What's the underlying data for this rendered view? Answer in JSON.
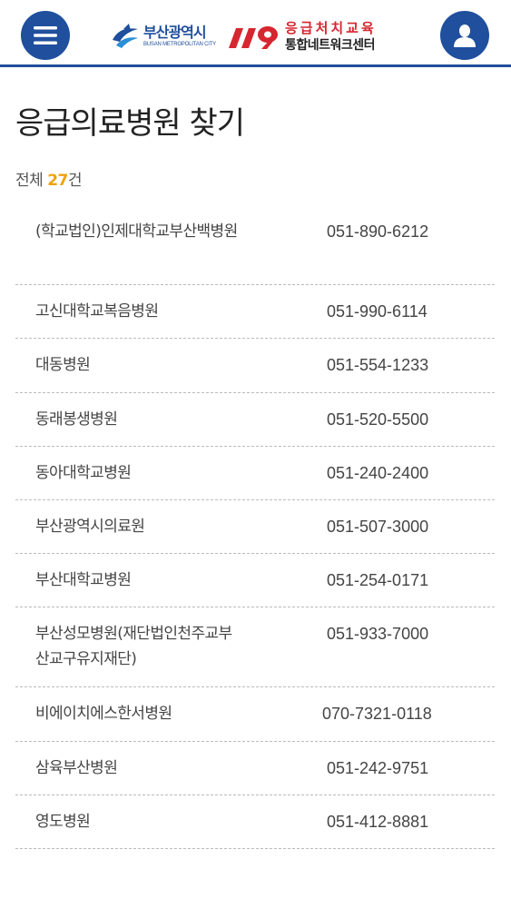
{
  "header": {
    "busan_name": "부산광역시",
    "busan_sub": "BUSAN METROPOLITAN CITY",
    "center_line1": "응급처치교육",
    "center_line2": "통합네트워크센터",
    "brand_color": "#1f4f9d",
    "accent_red": "#d6262f",
    "icons": [
      "menu-icon",
      "user-icon"
    ]
  },
  "page": {
    "title": "응급의료병원 찾기",
    "count_prefix": "전체 ",
    "count_value": "27",
    "count_suffix": "건",
    "count_color": "#f0a30a"
  },
  "hospitals": [
    {
      "name": "(학교법인)인제대학교부산백병원",
      "phone": "051-890-6212"
    },
    {
      "name": "고신대학교복음병원",
      "phone": "051-990-6114"
    },
    {
      "name": "대동병원",
      "phone": "051-554-1233"
    },
    {
      "name": "동래봉생병원",
      "phone": "051-520-5500"
    },
    {
      "name": "동아대학교병원",
      "phone": "051-240-2400"
    },
    {
      "name": "부산광역시의료원",
      "phone": "051-507-3000"
    },
    {
      "name": "부산대학교병원",
      "phone": "051-254-0171"
    },
    {
      "name": "부산성모병원(재단법인천주교부산교구유지재단)",
      "phone": "051-933-7000"
    },
    {
      "name": "비에이치에스한서병원",
      "phone": "070-7321-0118"
    },
    {
      "name": "삼육부산병원",
      "phone": "051-242-9751"
    },
    {
      "name": "영도병원",
      "phone": "051-412-8881"
    }
  ]
}
